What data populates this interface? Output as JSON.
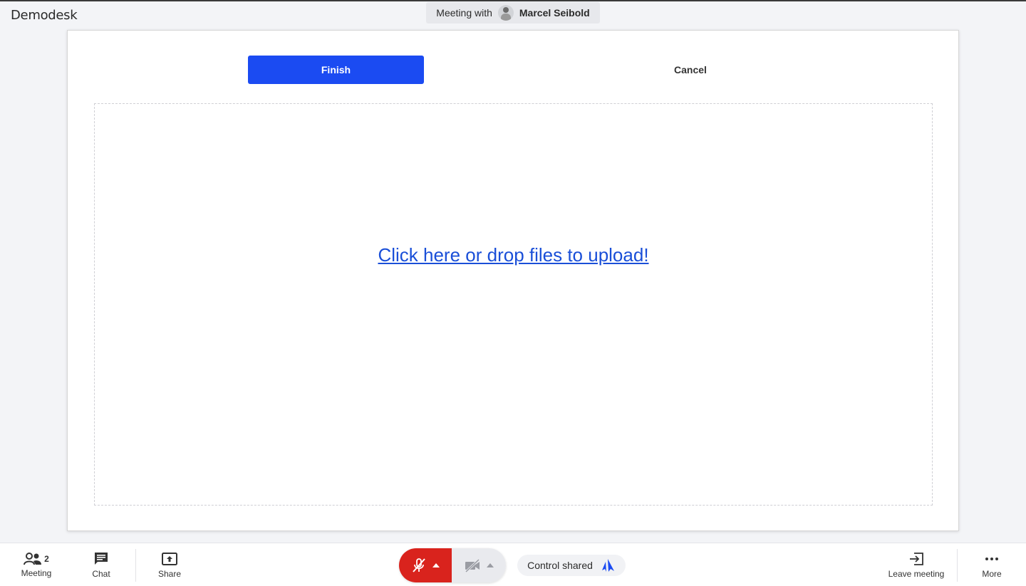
{
  "app": {
    "logo_text": "Demodesk"
  },
  "header": {
    "meeting_prefix": "Meeting with",
    "participant_name": "Marcel Seibold"
  },
  "upload_dialog": {
    "finish_label": "Finish",
    "cancel_label": "Cancel",
    "dropzone_text": "Click here or drop files to upload!"
  },
  "toolbar": {
    "meeting_label": "Meeting",
    "participant_count": "2",
    "chat_label": "Chat",
    "share_label": "Share",
    "control_shared_label": "Control shared",
    "leave_label": "Leave meeting",
    "more_label": "More"
  },
  "colors": {
    "primary": "#1b4bf2",
    "mic_muted": "#d9231d",
    "link": "#1a4fd8"
  }
}
